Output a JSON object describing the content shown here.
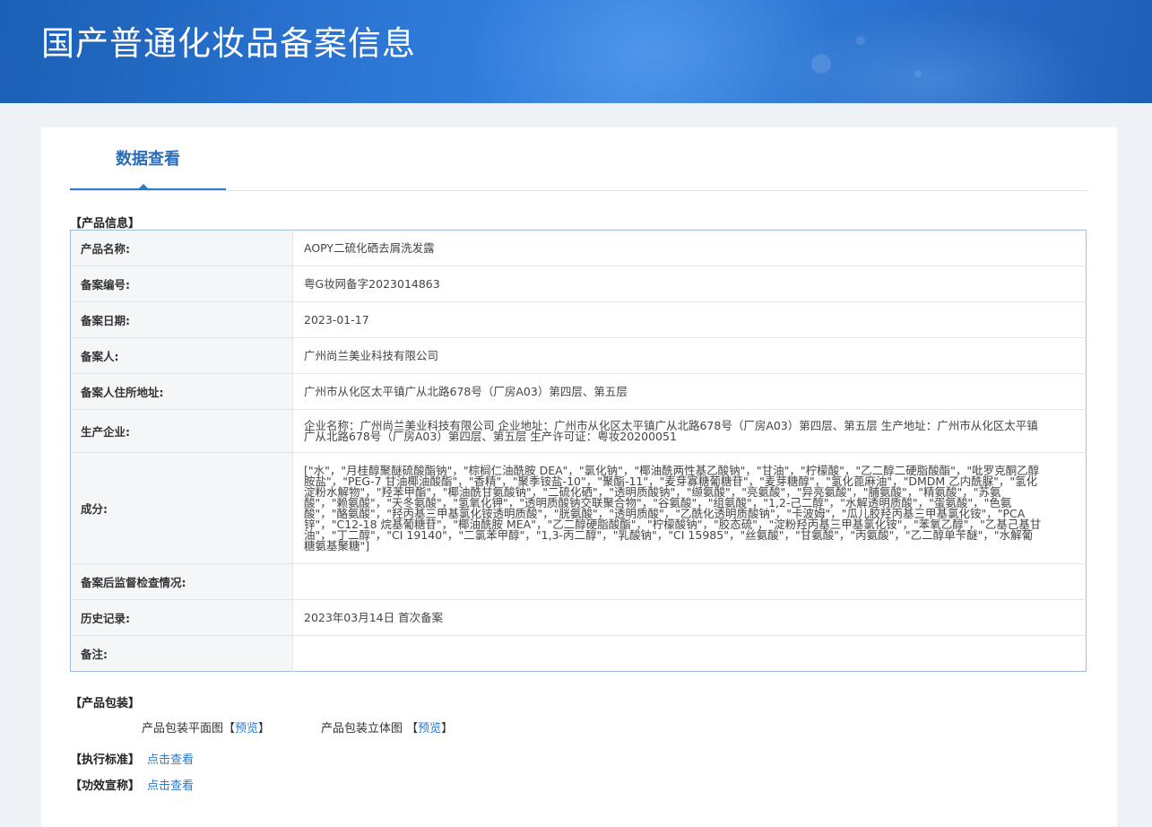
{
  "header": {
    "title": "国产普通化妆品备案信息"
  },
  "tabs": [
    {
      "label": "数据查看"
    }
  ],
  "product_info": {
    "section_label": "【产品信息】",
    "rows": [
      {
        "key": "产品名称:",
        "value": "AOPY二硫化硒去屑洗发露"
      },
      {
        "key": "备案编号:",
        "value": "粤G妆网备字2023014863"
      },
      {
        "key": "备案日期:",
        "value": "2023-01-17"
      },
      {
        "key": "备案人:",
        "value": "广州尚兰美业科技有限公司"
      },
      {
        "key": "备案人住所地址:",
        "value": "广州市从化区太平镇广从北路678号（厂房A03）第四层、第五层"
      },
      {
        "key": "生产企业:",
        "value": "企业名称：广州尚兰美业科技有限公司 企业地址：广州市从化区太平镇广从北路678号（厂房A03）第四层、第五层 生产地址：广州市从化区太平镇广从北路678号（厂房A03）第四层、第五层 生产许可证：粤妆20200051"
      },
      {
        "key": "成分:",
        "value": "[\"水\"，\"月桂醇聚醚硫酸酯钠\"，\"棕榈仁油酰胺 DEA\"，\"氯化钠\"，\"椰油酰两性基乙酸钠\"，\"甘油\"，\"柠檬酸\"，\"乙二醇二硬脂酸酯\"，\"吡罗克酮乙醇胺盐\"，\"PEG-7 甘油椰油酸酯\"，\"香精\"，\"聚季铵盐-10\"，\"聚酯-11\"，\"麦芽寡糖葡糖苷\"，\"麦芽糖醇\"，\"氢化蓖麻油\"，\"DMDM 乙内酰脲\"，\"氢化淀粉水解物\"，\"羟苯甲酯\"，\"椰油酰甘氨酸钠\"，\"二硫化硒\"，\"透明质酸钠\"，\"缬氨酸\"，\"亮氨酸\"，\"异亮氨酸\"，\"脯氨酸\"，\"精氨酸\"，\"苏氨酸\"，\"赖氨酸\"，\"天冬氨酸\"，\"氢氧化钾\"，\"透明质酸钠交联聚合物\"，\"谷氨酸\"，\"组氨酸\"，\"1,2-己二醇\"，\"水解透明质酸\"，\"蛋氨酸\"，\"色氨酸\"，\"酪氨酸\"，\"羟丙基三甲基氯化铵透明质酸\"，\"胱氨酸\"，\"透明质酸\"，\"乙酰化透明质酸钠\"，\"卡波姆\"，\"瓜儿胶羟丙基三甲基氯化铵\"，\"PCA 锌\"，\"C12-18 烷基葡糖苷\"，\"椰油酰胺 MEA\"，\"乙二醇硬脂酸酯\"，\"柠檬酸钠\"，\"胶态硫\"，\"淀粉羟丙基三甲基氯化铵\"，\"苯氧乙醇\"，\"乙基己基甘油\"，\"丁二醇\"，\"CI 19140\"，\"二氯苯甲醇\"，\"1,3-丙二醇\"，\"乳酸钠\"，\"CI 15985\"，\"丝氨酸\"，\"甘氨酸\"，\"丙氨酸\"，\"乙二醇单苄醚\"，\"水解葡糖氨基聚糖\"]"
      },
      {
        "key": "备案后监督检查情况:",
        "value": ""
      },
      {
        "key": "历史记录:",
        "value": "2023年03月14日 首次备案"
      },
      {
        "key": "备注:",
        "value": ""
      }
    ]
  },
  "packaging": {
    "section_label": "【产品包装】",
    "flat": {
      "label": "产品包装平面图",
      "open": "【",
      "link": "预览",
      "close": "】"
    },
    "stereo": {
      "label": "产品包装立体图",
      "open": "【",
      "link": "预览",
      "close": "】"
    }
  },
  "standard": {
    "label": "【执行标准】",
    "link": "点击查看"
  },
  "efficacy": {
    "label": "【功效宣称】",
    "link": "点击查看"
  }
}
